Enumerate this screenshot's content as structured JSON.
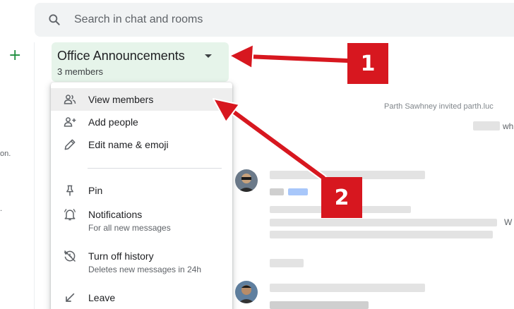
{
  "search": {
    "placeholder": "Search in chat and rooms"
  },
  "room": {
    "title": "Office Announcements",
    "members": "3 members"
  },
  "menu": {
    "items": [
      {
        "label": "View members",
        "icon": "people-icon"
      },
      {
        "label": "Add people",
        "icon": "person-add-icon"
      },
      {
        "label": "Edit name & emoji",
        "icon": "pencil-icon"
      },
      {
        "label": "Pin",
        "icon": "pin-icon"
      },
      {
        "label": "Notifications",
        "sub": "For all new messages",
        "icon": "bell-icon"
      },
      {
        "label": "Turn off history",
        "sub": "Deletes new messages in 24h",
        "icon": "history-off-icon"
      },
      {
        "label": "Leave",
        "icon": "leave-icon"
      }
    ]
  },
  "chat": {
    "system_message": "Parth Sawhney invited parth.luc",
    "trunc_right_1": "wh",
    "trunc_right_2": "W"
  },
  "left_fragments": [
    "on.",
    "."
  ],
  "annotations": [
    {
      "label": "1"
    },
    {
      "label": "2"
    }
  ],
  "colors": {
    "annotation": "#d7171f",
    "room_highlight": "#e6f4ea",
    "accent_green": "#1e8e3e"
  }
}
